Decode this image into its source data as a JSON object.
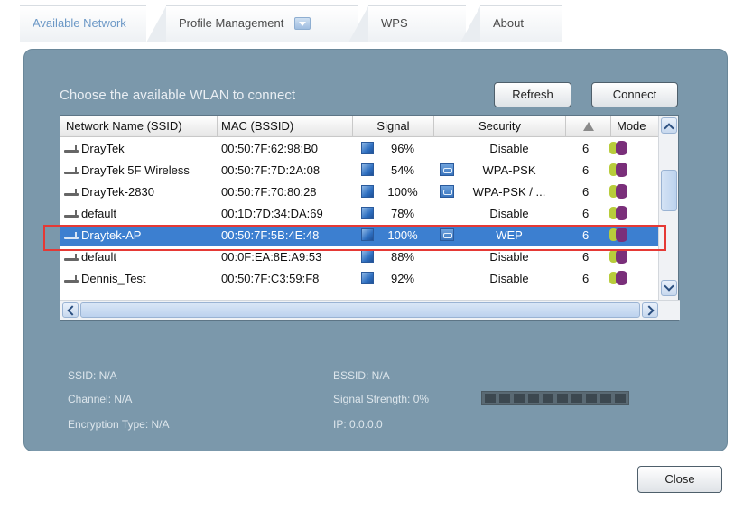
{
  "tabs": [
    {
      "label": "Available Network",
      "active": true
    },
    {
      "label": "Profile Management",
      "active": false
    },
    {
      "label": "WPS",
      "active": false
    },
    {
      "label": "About",
      "active": false
    }
  ],
  "panel": {
    "title": "Choose the available WLAN to connect",
    "refresh_label": "Refresh",
    "connect_label": "Connect"
  },
  "columns": {
    "ssid": "Network Name (SSID)",
    "mac": "MAC (BSSID)",
    "signal": "Signal",
    "security": "Security",
    "mode": "Mode"
  },
  "networks": [
    {
      "ssid": "DrayTek",
      "mac": "00:50:7F:62:98:B0",
      "signal": "96%",
      "security": "Disable",
      "channel": "6",
      "security_icon": false
    },
    {
      "ssid": "DrayTek 5F Wireless",
      "mac": "00:50:7F:7D:2A:08",
      "signal": "54%",
      "security": "WPA-PSK",
      "channel": "6",
      "security_icon": true
    },
    {
      "ssid": "DrayTek-2830",
      "mac": "00:50:7F:70:80:28",
      "signal": "100%",
      "security": "WPA-PSK / ...",
      "channel": "6",
      "security_icon": true
    },
    {
      "ssid": "default",
      "mac": "00:1D:7D:34:DA:69",
      "signal": "78%",
      "security": "Disable",
      "channel": "6",
      "security_icon": false
    },
    {
      "ssid": "Draytek-AP",
      "mac": "00:50:7F:5B:4E:48",
      "signal": "100%",
      "security": "WEP",
      "channel": "6",
      "security_icon": true,
      "selected": true
    },
    {
      "ssid": "default",
      "mac": "00:0F:EA:8E:A9:53",
      "signal": "88%",
      "security": "Disable",
      "channel": "6",
      "security_icon": false
    },
    {
      "ssid": "Dennis_Test",
      "mac": "00:50:7F:C3:59:F8",
      "signal": "92%",
      "security": "Disable",
      "channel": "6",
      "security_icon": false
    }
  ],
  "info": {
    "ssid": "SSID: N/A",
    "channel": "Channel: N/A",
    "encryption": "Encryption Type: N/A",
    "bssid": "BSSID: N/A",
    "signal_strength": "Signal Strength: 0%",
    "ip": "IP: 0.0.0.0",
    "signal_level": 0
  },
  "close_label": "Close",
  "colors": {
    "panel": "#7b98ab",
    "selection": "#3c7fd0",
    "highlight": "#e53935",
    "active_tab": "#6c98c6"
  }
}
